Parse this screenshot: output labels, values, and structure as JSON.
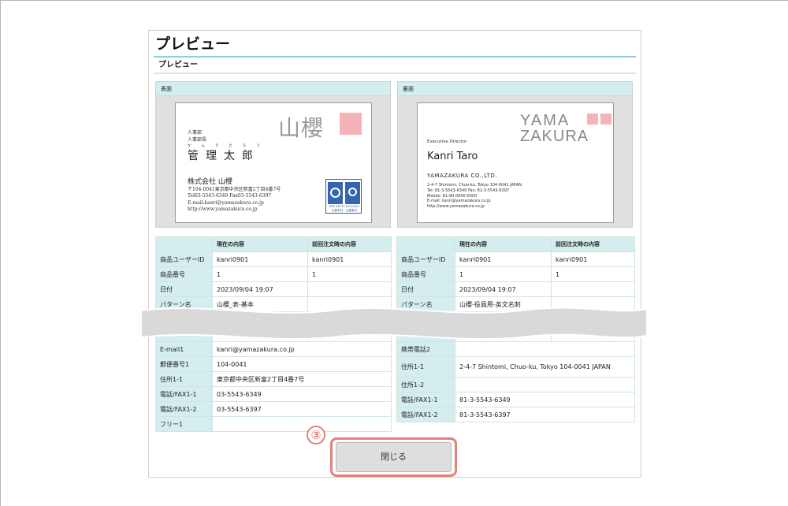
{
  "page": {
    "title": "プレビュー",
    "section_title": "プレビュー"
  },
  "front": {
    "label": "表面",
    "card": {
      "dept1": "人事部",
      "dept2": "人事部長",
      "name_kana": "かんりたろう",
      "name": "管理太郎",
      "logo": "山櫻",
      "company": "株式会社 山櫻",
      "address": "〒104-0041東京都中央区新富2丁目4番7号",
      "tel": "Tel03-5543-6349 Fax03-5543-6397",
      "email": "E-mail:kanri@yamazakura.co.jp",
      "url": "http://www.yamazakura.co.jp",
      "cert_caption1": "EMS 56741  ISO14001",
      "cert_caption2": "山櫻本社・山櫻東京"
    },
    "table": {
      "headers": [
        "",
        "現在の内容",
        "前回注文時の内容"
      ],
      "rows": [
        [
          "商品ユーザーID",
          "kanri0901",
          "kanri0901"
        ],
        [
          "商品番号",
          "1",
          "1"
        ],
        [
          "日付",
          "2023/09/04 19:07",
          ""
        ],
        [
          "パターン名",
          "山櫻_表-基本",
          ""
        ]
      ],
      "rows_after_tear": [
        [
          "E-mail1",
          "kanri@yamazakura.co.jp"
        ],
        [
          "郵便番号1",
          "104-0041"
        ],
        [
          "住所1-1",
          "東京都中央区新富2丁目4番7号"
        ],
        [
          "電話/FAX1-1",
          "03-5543-6349"
        ],
        [
          "電話/FAX1-2",
          "03-5543-6397"
        ],
        [
          "フリー1",
          ""
        ]
      ]
    }
  },
  "back": {
    "label": "裏面",
    "card": {
      "logo_line1": "YAMA",
      "logo_line2": "ZAKURA",
      "title": "Executive Director",
      "name": "Kanri Taro",
      "company": "YAMAZAKURA CO.,LTD.",
      "address": "2-4-7 Shintomi, Chuo-ku, Tokyo 104-0041 JAPAN",
      "tel": "Tel: 81-3-5543-6349 Fax: 81-3-5543-6397",
      "mobile": "Mobile: 81-90-0000-0000",
      "email": "E-mail: kanri@yamazakura.co.jp",
      "url": "http://www.yamazakura.co.jp"
    },
    "table": {
      "headers": [
        "",
        "現在の内容",
        "前回注文時の内容"
      ],
      "rows": [
        [
          "商品ユーザーID",
          "kanri0901",
          "kanri0901"
        ],
        [
          "商品番号",
          "1",
          "1"
        ],
        [
          "日付",
          "2023/09/04 19:07",
          ""
        ],
        [
          "パターン名",
          "山櫻-役員用-英文名刺",
          ""
        ]
      ],
      "rows_after_tear": [
        [
          "携帯電話2",
          ""
        ],
        [
          "住所1-1",
          "2-4-7 Shintomi, Chuo-ku, Tokyo 104-0041 JAPAN"
        ],
        [
          "住所1-2",
          ""
        ],
        [
          "電話/FAX1-1",
          "81-3-5543-6349"
        ],
        [
          "電話/FAX1-2",
          "81-3-5543-6397"
        ]
      ]
    }
  },
  "step_badge": "③",
  "close_button": "閉じる",
  "colors": {
    "accent_teal": "#8fd0d4",
    "header_bg": "#d4eeef",
    "highlight": "#e0827a",
    "logo_pink": "#f5b3b8"
  }
}
